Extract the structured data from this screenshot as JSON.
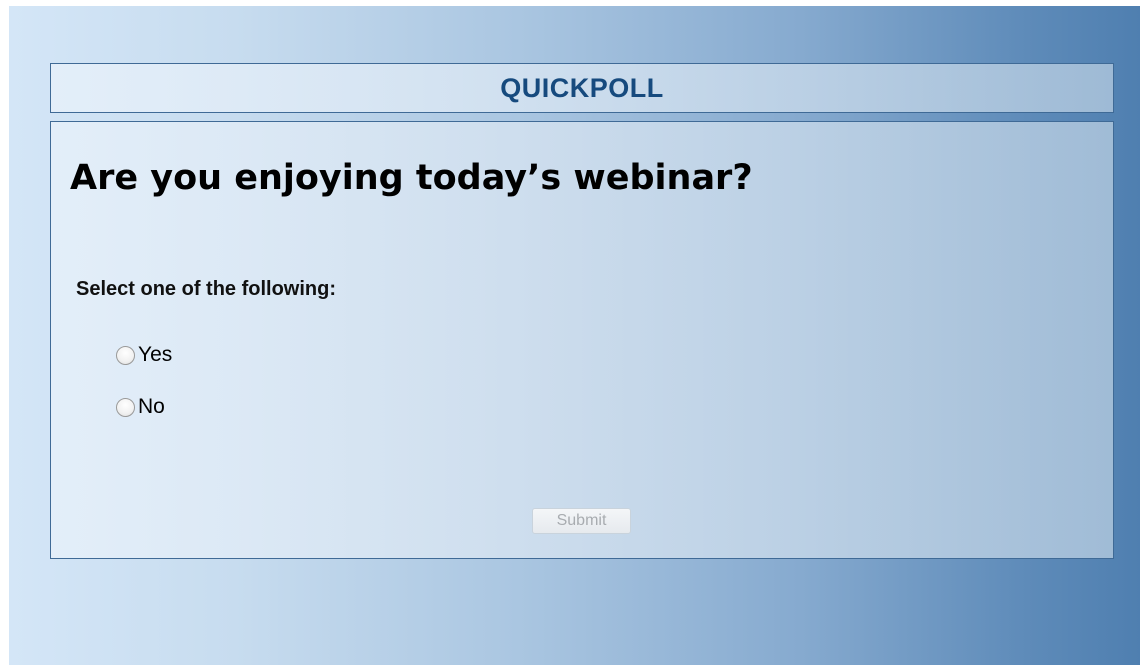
{
  "header": {
    "title": "QUICKPOLL"
  },
  "poll": {
    "question": "Are you enjoying today’s webinar?",
    "instruction": "Select one of the following:",
    "options": [
      {
        "label": "Yes",
        "selected": false
      },
      {
        "label": "No",
        "selected": false
      }
    ],
    "submit_label": "Submit",
    "submit_enabled": false
  },
  "colors": {
    "title_text": "#164a7e",
    "border": "#3f6a96",
    "background_light": "#d4e6f7",
    "background_dark": "#4f7fb0"
  }
}
